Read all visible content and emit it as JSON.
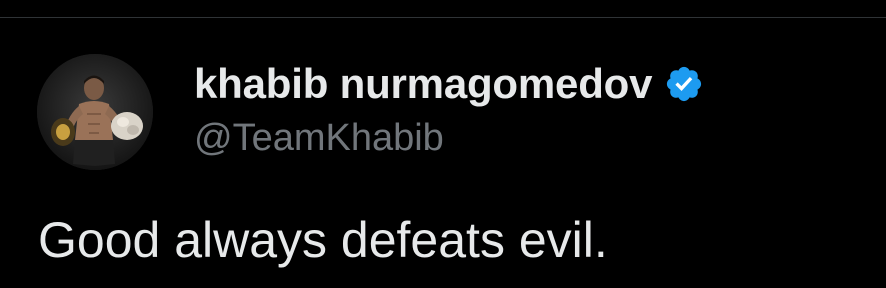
{
  "tweet": {
    "author": {
      "display_name": "khabib nurmagomedov",
      "handle": "@TeamKhabib",
      "verified": true,
      "avatar_icon": "profile-photo-fighter-with-belts"
    },
    "text": "Good always defeats evil."
  },
  "colors": {
    "background": "#000000",
    "primary_text": "#e7e9ea",
    "secondary_text": "#71767b",
    "verified_badge": "#1d9bf0",
    "divider": "#2f3336"
  }
}
